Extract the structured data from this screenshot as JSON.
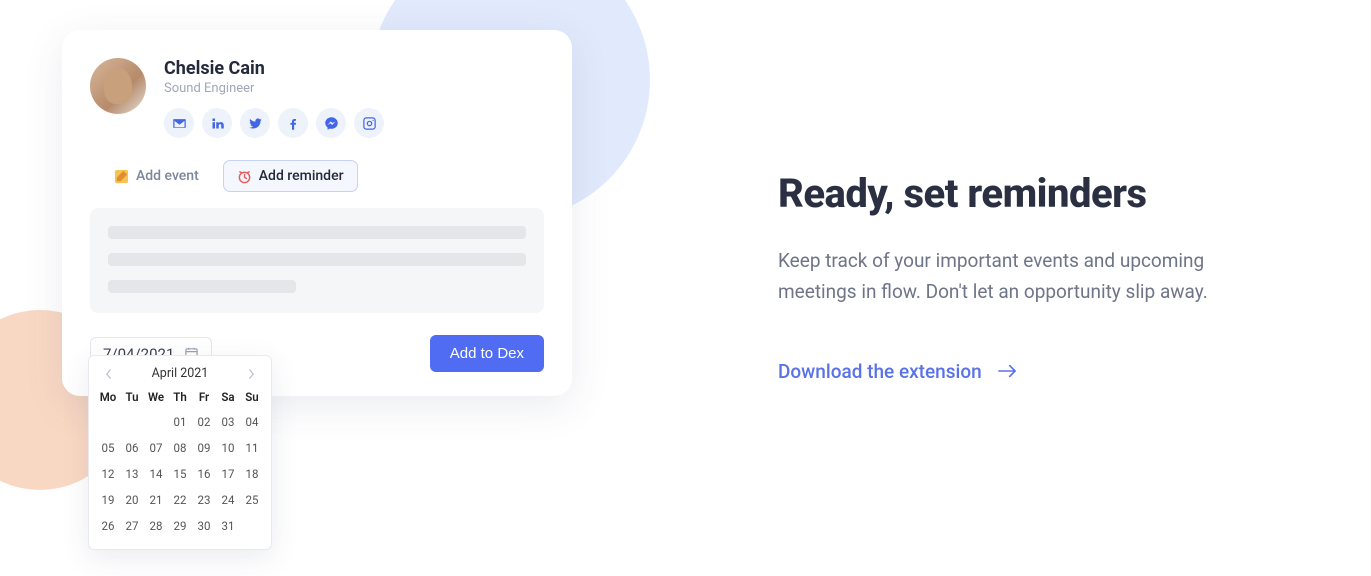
{
  "profile": {
    "name": "Chelsie Cain",
    "title": "Sound Engineer"
  },
  "actions": {
    "add_event": "Add event",
    "add_reminder": "Add reminder"
  },
  "date_input": "7/04/2021",
  "submit_label": "Add to Dex",
  "calendar": {
    "month_label": "April 2021",
    "dow": [
      "Mo",
      "Tu",
      "We",
      "Th",
      "Fr",
      "Sa",
      "Su"
    ],
    "days": [
      "01",
      "02",
      "03",
      "04",
      "05",
      "06",
      "07",
      "08",
      "09",
      "10",
      "11",
      "12",
      "13",
      "14",
      "15",
      "16",
      "17",
      "18",
      "19",
      "20",
      "21",
      "22",
      "23",
      "24",
      "25",
      "26",
      "27",
      "28",
      "29",
      "30",
      "31"
    ]
  },
  "hero": {
    "heading": "Ready, set reminders",
    "subtext": "Keep track of your important events and upcoming meetings in flow. Don't let an opportunity slip away.",
    "cta": "Download the extension"
  }
}
